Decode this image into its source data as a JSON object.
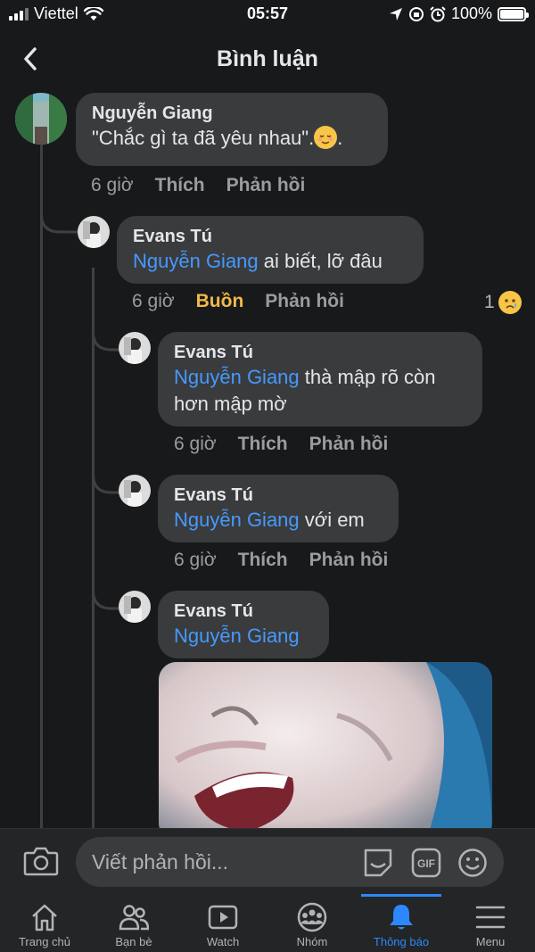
{
  "status_bar": {
    "carrier": "Viettel",
    "time": "05:57",
    "battery": "100%",
    "battery_level": 1.0
  },
  "header": {
    "title": "Bình luận"
  },
  "comments": [
    {
      "author": "Nguyễn Giang",
      "text": "\"Chắc gì ta đã yêu nhau\".",
      "trail": ".",
      "time": "6 giờ",
      "like": "Thích",
      "reply": "Phản hồi"
    },
    {
      "author": "Evans Tú",
      "mention": "Nguyễn Giang",
      "text": " ai biết, lỡ đâu",
      "time": "6 giờ",
      "reaction": "Buồn",
      "reply": "Phản hồi",
      "reaction_count": "1"
    },
    {
      "author": "Evans Tú",
      "mention": "Nguyễn Giang",
      "text": " thà mập rõ còn",
      "text2": "hơn mập mờ",
      "time": "6 giờ",
      "like": "Thích",
      "reply": "Phản hồi"
    },
    {
      "author": "Evans Tú",
      "mention": "Nguyễn Giang",
      "text": " với em",
      "time": "6 giờ",
      "like": "Thích",
      "reply": "Phản hồi"
    },
    {
      "author": "Evans Tú",
      "mention": "Nguyễn Giang"
    }
  ],
  "composer": {
    "placeholder": "Viết phản hồi..."
  },
  "tabs": [
    {
      "label": "Trang chủ",
      "icon": "home-icon"
    },
    {
      "label": "Bạn bè",
      "icon": "friends-icon"
    },
    {
      "label": "Watch",
      "icon": "watch-icon"
    },
    {
      "label": "Nhóm",
      "icon": "groups-icon"
    },
    {
      "label": "Thông báo",
      "icon": "bell-icon",
      "active": true
    },
    {
      "label": "Menu",
      "icon": "menu-icon"
    }
  ],
  "colors": {
    "background": "#18191a",
    "bubble": "#3a3b3c",
    "mention": "#4599ff",
    "sad_reaction": "#f0b94a",
    "active_tab": "#2d88ff"
  }
}
